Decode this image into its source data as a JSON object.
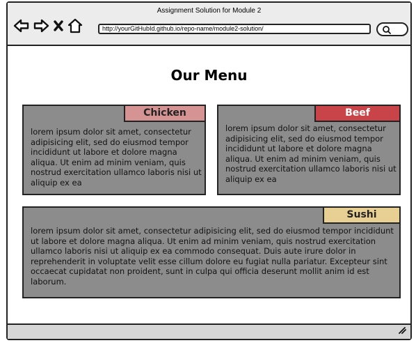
{
  "window": {
    "title": "Assignment Solution for Module 2",
    "url": "http://yourGitHubId.github.io/repo-name/module2-solution/"
  },
  "icons": {
    "back": "arrow-left-icon",
    "forward": "arrow-right-icon",
    "stop": "close-icon",
    "home": "home-icon",
    "search": "search-icon",
    "resize": "resize-grip-icon"
  },
  "page": {
    "title": "Our Menu"
  },
  "menu": {
    "chicken": {
      "label": "Chicken",
      "color": "#d59393",
      "text": "lorem ipsum dolor sit amet, consectetur adipisicing elit, sed do eiusmod tempor incididunt ut labore et dolore magna aliqua. Ut enim ad minim veniam, quis nostrud exercitation ullamco laboris nisi ut aliquip ex ea"
    },
    "beef": {
      "label": "Beef",
      "color": "#c94448",
      "text": "lorem ipsum dolor sit amet, consectetur adipisicing elit, sed do eiusmod tempor incididunt ut labore et dolore magna aliqua. Ut enim ad minim veniam, quis nostrud exercitation ullamco laboris nisi ut aliquip ex ea"
    },
    "sushi": {
      "label": "Sushi",
      "color": "#e8cf94",
      "text": "lorem ipsum dolor sit amet, consectetur adipisicing elit, sed do eiusmod tempor incididunt ut labore et dolore magna aliqua. Ut enim ad minim veniam, quis nostrud exercitation ullamco laboris nisi ut aliquip ex ea commodo consequat. Duis aute irure dolor in reprehenderit in voluptate velit esse cillum dolore eu fugiat nulla pariatur. Excepteur sint occaecat cupidatat non proident, sunt in culpa qui officia deserunt mollit anim id est laborum."
    }
  }
}
